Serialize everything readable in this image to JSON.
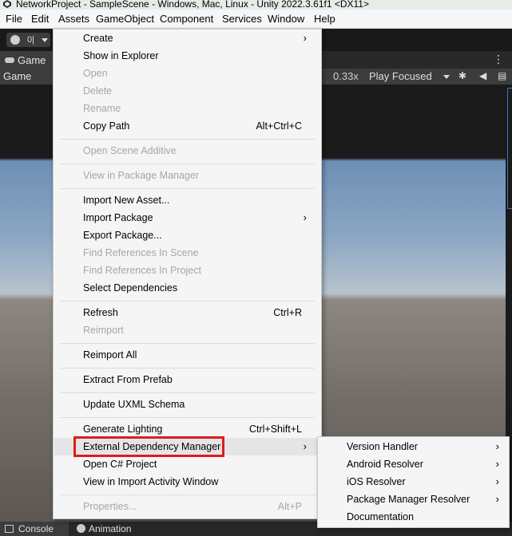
{
  "window": {
    "title": "NetworkProject - SampleScene - Windows, Mac, Linux - Unity 2022.3.61f1 <DX11>"
  },
  "menubar": [
    "File",
    "Edit",
    "Assets",
    "GameObject",
    "Component",
    "Services",
    "Window",
    "Help"
  ],
  "toolbar": {
    "account_label": "0|"
  },
  "game_view": {
    "tab_label": "Game",
    "mode_label": "Game",
    "zoom": "0.33x",
    "play_mode": "Play Focused"
  },
  "bottom_tabs": [
    "Console",
    "Animation"
  ],
  "assets_menu": {
    "items": [
      {
        "label": "Create",
        "submenu": true
      },
      {
        "label": "Show in Explorer"
      },
      {
        "label": "Open",
        "disabled": true
      },
      {
        "label": "Delete",
        "disabled": true
      },
      {
        "label": "Rename",
        "disabled": true
      },
      {
        "label": "Copy Path",
        "shortcut": "Alt+Ctrl+C"
      },
      {
        "label": "Open Scene Additive",
        "disabled": true
      },
      {
        "label": "View in Package Manager",
        "disabled": true
      },
      {
        "label": "Import New Asset..."
      },
      {
        "label": "Import Package",
        "submenu": true
      },
      {
        "label": "Export Package..."
      },
      {
        "label": "Find References In Scene",
        "disabled": true
      },
      {
        "label": "Find References In Project",
        "disabled": true
      },
      {
        "label": "Select Dependencies"
      },
      {
        "label": "Refresh",
        "shortcut": "Ctrl+R"
      },
      {
        "label": "Reimport",
        "disabled": true
      },
      {
        "label": "Reimport All"
      },
      {
        "label": "Extract From Prefab"
      },
      {
        "label": "Update UXML Schema"
      },
      {
        "label": "Generate Lighting",
        "shortcut": "Ctrl+Shift+L"
      },
      {
        "label": "External Dependency Manager",
        "submenu": true,
        "highlighted": true
      },
      {
        "label": "Open C# Project"
      },
      {
        "label": "View in Import Activity Window"
      },
      {
        "label": "Properties...",
        "shortcut": "Alt+P",
        "disabled": true
      }
    ]
  },
  "edm_submenu": {
    "items": [
      {
        "label": "Version Handler",
        "submenu": true
      },
      {
        "label": "Android Resolver",
        "submenu": true
      },
      {
        "label": "iOS Resolver",
        "submenu": true
      },
      {
        "label": "Package Manager Resolver",
        "submenu": true
      },
      {
        "label": "Documentation"
      }
    ]
  },
  "glyphs": {
    "submenu_arrow": "›",
    "kebab": "⋮"
  },
  "colors": {
    "highlight_border": "#e01b1b",
    "disabled_text": "#a6a6a6"
  }
}
